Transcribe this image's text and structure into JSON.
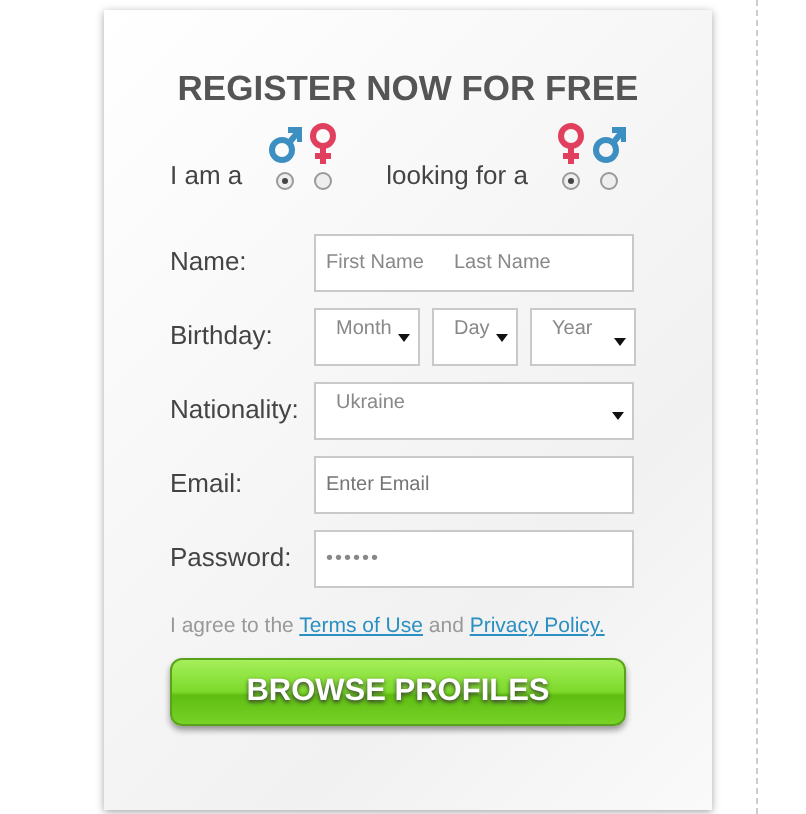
{
  "title": "REGISTER NOW FOR FREE",
  "gender": [
    {
      "label": "I am a",
      "options": [
        {
          "kind": "male",
          "selected": true
        },
        {
          "kind": "female",
          "selected": false
        }
      ]
    },
    {
      "label": "looking for a",
      "options": [
        {
          "kind": "female",
          "selected": true
        },
        {
          "kind": "male",
          "selected": false
        }
      ]
    }
  ],
  "fields": [
    {
      "kind": "name",
      "label": "Name:",
      "placeholders": [
        "First Name",
        "Last Name"
      ]
    },
    {
      "kind": "selects",
      "label": "Birthday:",
      "selects": [
        "Month",
        "Day",
        "Year"
      ]
    },
    {
      "kind": "selects",
      "label": "Nationality:",
      "selects": [
        "Ukraine"
      ]
    },
    {
      "kind": "text",
      "label": "Email:",
      "placeholder": "Enter Email"
    },
    {
      "kind": "password",
      "label": "Password:",
      "value": "••••••"
    }
  ],
  "agreement": {
    "text": "I agree to the",
    "terms_link": "Terms of Use",
    "and": "and",
    "privacy_link": "Privacy Policy."
  },
  "button": "BROWSE PROFILES"
}
